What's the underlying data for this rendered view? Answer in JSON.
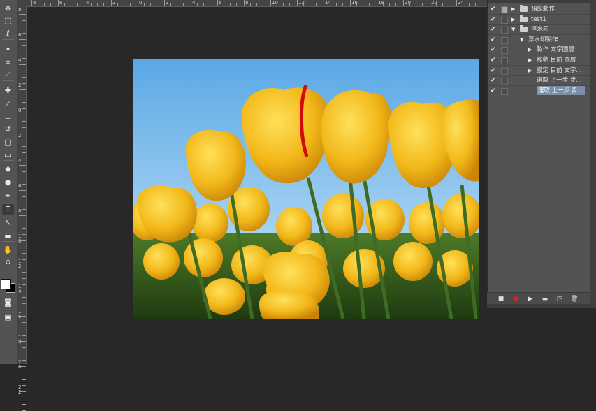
{
  "toolbar": {
    "tools": [
      {
        "name": "move-tool-icon",
        "glyph": "✥"
      },
      {
        "name": "marquee-tool-icon",
        "glyph": "⬚"
      },
      {
        "name": "lasso-tool-icon",
        "glyph": "ℓ"
      },
      {
        "name": "magic-wand-tool-icon",
        "glyph": "✶"
      },
      {
        "name": "crop-tool-icon",
        "glyph": "⌗"
      },
      {
        "name": "eyedropper-tool-icon",
        "glyph": "⟋"
      },
      {
        "name": "healing-brush-tool-icon",
        "glyph": "✚"
      },
      {
        "name": "brush-tool-icon",
        "glyph": "⟋"
      },
      {
        "name": "clone-stamp-tool-icon",
        "glyph": "⊥"
      },
      {
        "name": "history-brush-tool-icon",
        "glyph": "↺"
      },
      {
        "name": "eraser-tool-icon",
        "glyph": "◫"
      },
      {
        "name": "gradient-tool-icon",
        "glyph": "▭"
      },
      {
        "name": "blur-tool-icon",
        "glyph": "◆"
      },
      {
        "name": "dodge-tool-icon",
        "glyph": "●"
      },
      {
        "name": "pen-tool-icon",
        "glyph": "✒"
      },
      {
        "name": "type-tool-icon",
        "glyph": "T"
      },
      {
        "name": "path-selection-tool-icon",
        "glyph": "↖"
      },
      {
        "name": "shape-tool-icon",
        "glyph": "▬"
      },
      {
        "name": "hand-tool-icon",
        "glyph": "✋"
      },
      {
        "name": "zoom-tool-icon",
        "glyph": "⚲"
      }
    ],
    "extra": [
      {
        "name": "quick-mask-icon",
        "glyph": "◙"
      },
      {
        "name": "screen-mode-icon",
        "glyph": "▣"
      }
    ]
  },
  "ruler_left": {
    "labels": [
      "8",
      "6",
      "4",
      "2",
      "0",
      "2",
      "4",
      "6",
      "8",
      "1\n0",
      "1\n2",
      "1\n4",
      "1\n6",
      "1\n8",
      "2\n0",
      "2\n2"
    ]
  },
  "ruler_top": {
    "labels": [
      "8",
      "6",
      "4",
      "2",
      "0",
      "2",
      "4",
      "6",
      "8",
      "10",
      "12",
      "14",
      "16",
      "18",
      "20",
      "22",
      "24"
    ]
  },
  "actions_panel": {
    "rows": [
      {
        "label": "預設動作",
        "check": "✔",
        "dialog": "on",
        "expand": "▶",
        "folder": true,
        "indent": 0
      },
      {
        "label": "test1",
        "check": "✔",
        "dialog": "off",
        "expand": "▶",
        "folder": true,
        "indent": 0
      },
      {
        "label": "浮水印",
        "check": "✔",
        "dialog": "off",
        "expand": "▼",
        "folder": true,
        "open": true,
        "indent": 0
      },
      {
        "label": "浮水印製作",
        "check": "✔",
        "dialog": "off",
        "expand": "▼",
        "folder": false,
        "indent": 1
      },
      {
        "label": "製作 文字圖層",
        "check": "✔",
        "dialog": "off",
        "expand": "▶",
        "folder": false,
        "indent": 2
      },
      {
        "label": "移動 目前 圖層",
        "check": "✔",
        "dialog": "off",
        "expand": "▶",
        "folder": false,
        "indent": 2
      },
      {
        "label": "設定 目前 文字...",
        "check": "✔",
        "dialog": "off",
        "expand": "▶",
        "folder": false,
        "indent": 2
      },
      {
        "label": "選取 上一步 步...",
        "check": "✔",
        "dialog": "off",
        "expand": "",
        "folder": false,
        "indent": 2
      },
      {
        "label": "選取 上一步 步...",
        "check": "✔",
        "dialog": "off",
        "expand": "",
        "folder": false,
        "indent": 2,
        "selected": true
      }
    ],
    "bottom_buttons": [
      {
        "name": "stop-button",
        "glyph": "■"
      },
      {
        "name": "record-button",
        "glyph": "●",
        "color": "#e02020"
      },
      {
        "name": "play-button",
        "glyph": "▶"
      },
      {
        "name": "new-set-button",
        "glyph": "▬"
      },
      {
        "name": "new-action-button",
        "glyph": "◳"
      },
      {
        "name": "delete-button",
        "glyph": "🗑"
      }
    ]
  },
  "colors": {
    "workspace": "#282828",
    "panel": "#535353",
    "sky": "#7fbde8",
    "tulip": "#f2b81a",
    "stem": "#3f6b22",
    "highlight": "#7a8fa6"
  }
}
